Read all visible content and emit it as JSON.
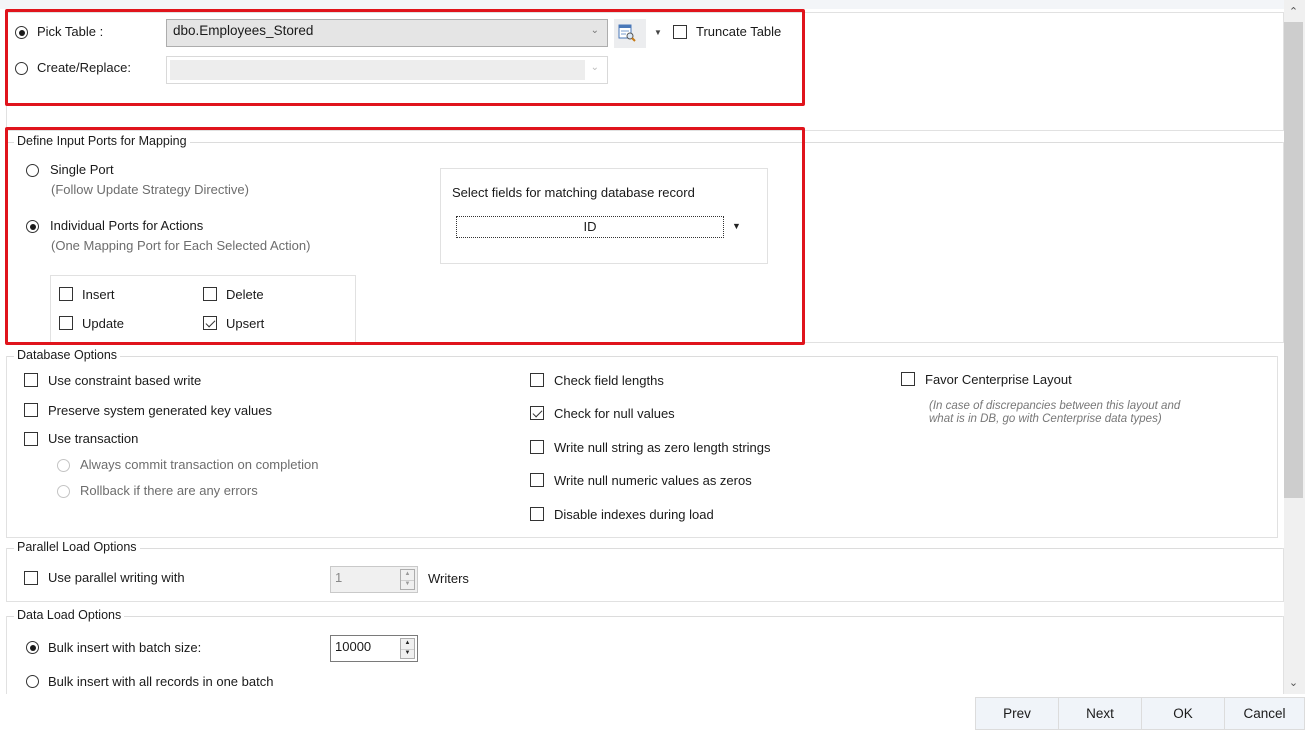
{
  "table_select": {
    "pick_table_label": "Pick Table :",
    "pick_table_selected": true,
    "pick_table_value": "dbo.Employees_Stored",
    "create_replace_label": "Create/Replace:",
    "create_replace_selected": false,
    "create_replace_value": "",
    "truncate_table_label": "Truncate Table",
    "truncate_table_checked": false,
    "table_browse_icon": "table-search-icon"
  },
  "input_ports": {
    "legend": "Define Input Ports for Mapping",
    "single_port_label": "Single Port",
    "single_port_desc": "(Follow Update Strategy Directive)",
    "single_port_selected": false,
    "individual_ports_label": "Individual Ports for Actions",
    "individual_ports_desc": "(One Mapping Port for Each Selected Action)",
    "individual_ports_selected": true,
    "actions": [
      {
        "label": "Insert",
        "checked": false
      },
      {
        "label": "Delete",
        "checked": false
      },
      {
        "label": "Update",
        "checked": false
      },
      {
        "label": "Upsert",
        "checked": true
      }
    ],
    "match_fields_label": "Select fields for matching database record",
    "match_fields_value": "ID"
  },
  "database_options": {
    "legend": "Database  Options",
    "left": [
      {
        "label": "Use constraint based write",
        "checked": false
      },
      {
        "label": "Preserve system generated key values",
        "checked": false
      },
      {
        "label": "Use transaction",
        "checked": false
      }
    ],
    "transaction_radios": [
      {
        "label": "Always commit transaction on completion",
        "selected": false,
        "disabled": true
      },
      {
        "label": "Rollback if there are any errors",
        "selected": false,
        "disabled": true
      }
    ],
    "middle": [
      {
        "label": "Check field lengths",
        "checked": false
      },
      {
        "label": "Check for null values",
        "checked": true
      },
      {
        "label": "Write null string as zero length strings",
        "checked": false
      },
      {
        "label": "Write null numeric values as zeros",
        "checked": false
      },
      {
        "label": "Disable indexes during load",
        "checked": false
      }
    ],
    "favor_layout_label": "Favor Centerprise Layout",
    "favor_layout_checked": false,
    "favor_layout_note_line1": "(In case of discrepancies between this layout and",
    "favor_layout_note_line2": "what is in DB, go with Centerprise data types)"
  },
  "parallel_load": {
    "legend": "Parallel Load Options",
    "use_parallel_label": "Use parallel writing with",
    "use_parallel_checked": false,
    "writers_value": "1",
    "writers_label": "Writers"
  },
  "data_load": {
    "legend": "Data Load Options",
    "bulk_batch_label": "Bulk insert with batch size:",
    "bulk_batch_selected": true,
    "batch_size_value": "10000",
    "bulk_all_label": "Bulk insert with all records in one batch",
    "bulk_all_selected": false
  },
  "footer": {
    "prev": "Prev",
    "next": "Next",
    "ok": "OK",
    "cancel": "Cancel"
  },
  "highlight_color": "#e0141c"
}
